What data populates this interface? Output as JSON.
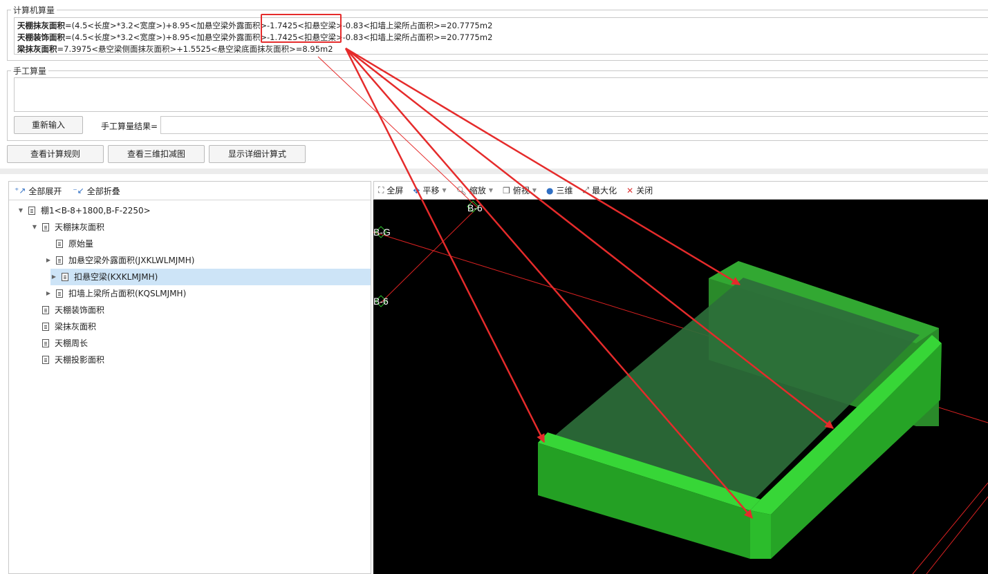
{
  "computer_group": {
    "legend": "计算机算量",
    "lines": [
      {
        "name": "天棚抹灰面积",
        "expr": "=(4.5<长度>*3.2<宽度>)+8.95<加悬空梁外露面积>-1.7425<扣悬空梁>-0.83<扣墙上梁所占面积>=20.7775m2"
      },
      {
        "name": "天棚装饰面积",
        "expr": "=(4.5<长度>*3.2<宽度>)+8.95<加悬空梁外露面积>-1.7425<扣悬空梁>-0.83<扣墙上梁所占面积>=20.7775m2"
      },
      {
        "name": "梁抹灰面积",
        "expr": "=7.3975<悬空梁侧面抹灰面积>+1.5525<悬空梁底面抹灰面积>=8.95m2"
      }
    ]
  },
  "manual_group": {
    "legend": "手工算量",
    "reinput_label": "重新输入",
    "result_label": "手工算量结果="
  },
  "buttons": {
    "view_rules": "查看计算规则",
    "view_3d": "查看三维扣减图",
    "show_detail": "显示详细计算式"
  },
  "tree_toolbar": {
    "expand_all": "全部展开",
    "collapse_all": "全部折叠"
  },
  "tree": [
    {
      "label": "棚1<B-8+1800,B-F-2250>",
      "level": 0,
      "toggle": "down",
      "selected": false
    },
    {
      "label": "天棚抹灰面积",
      "level": 1,
      "toggle": "down",
      "selected": false
    },
    {
      "label": "原始量",
      "level": 2,
      "toggle": "none",
      "selected": false
    },
    {
      "label": "加悬空梁外露面积(JXKLWLMJMH)",
      "level": 2,
      "toggle": "right",
      "selected": false
    },
    {
      "label": "扣悬空梁(KXKLMJMH)",
      "level": 2,
      "toggle": "right",
      "selected": true
    },
    {
      "label": "扣墙上梁所占面积(KQSLMJMH)",
      "level": 2,
      "toggle": "right",
      "selected": false
    },
    {
      "label": "天棚装饰面积",
      "level": 1,
      "toggle": "none",
      "selected": false
    },
    {
      "label": "梁抹灰面积",
      "level": 1,
      "toggle": "none",
      "selected": false
    },
    {
      "label": "天棚周长",
      "level": 1,
      "toggle": "none",
      "selected": false
    },
    {
      "label": "天棚投影面积",
      "level": 1,
      "toggle": "none",
      "selected": false
    }
  ],
  "view_toolbar": {
    "fullscreen": "全屏",
    "pan": "平移",
    "zoom": "缩放",
    "view": "俯视",
    "three_d": "三维",
    "maximize": "最大化",
    "close": "关闭"
  },
  "axis_labels": {
    "b6_top": "B-6",
    "bg_left": "B-G",
    "b6_left": "B-6"
  },
  "colors": {
    "highlight": "#e52b2b",
    "arrow": "#e52b2b",
    "beam_green": "#2fbf2f",
    "slab_green": "#2e7a3a",
    "selected_row": "#cde4f7"
  }
}
